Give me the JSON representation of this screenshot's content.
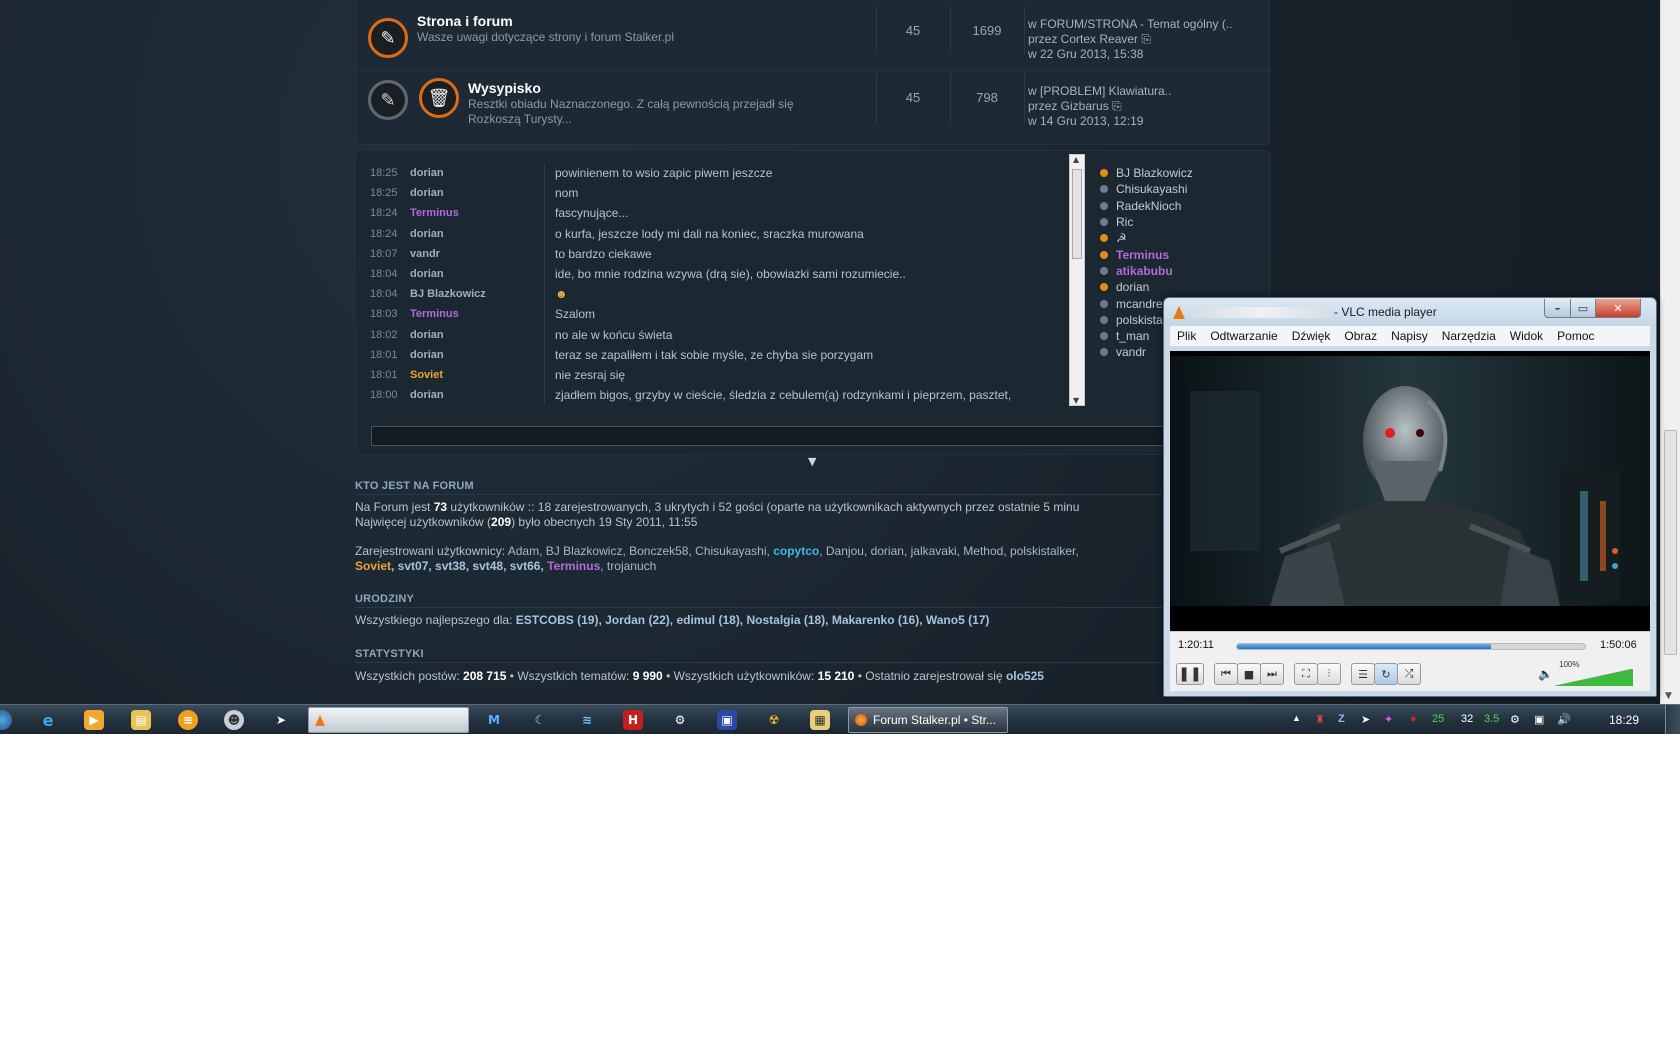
{
  "forums": [
    {
      "title": "Strona i forum",
      "desc": "Wasze uwagi dotyczące strony i forum Stalker.pl",
      "topics": "45",
      "posts": "1699",
      "last_line1": "w FORUM/STRONA - Temat ogólny (..",
      "last_line2": "przez Cortex Reaver",
      "last_line3": "w 22 Gru 2013, 15:38"
    },
    {
      "title": "Wysypisko",
      "desc": "Resztki obiadu Naznaczonego. Z całą pewnością przejadł się Rozkoszą Turysty...",
      "topics": "45",
      "posts": "798",
      "last_line1": "w [PROBLEM] Klawiatura..",
      "last_line2": "przez Gizbarus",
      "last_line3": "w 14 Gru 2013, 12:19"
    }
  ],
  "shoutbox": {
    "lines": [
      {
        "time": "18:25",
        "nick": "dorian",
        "msg": "powinienem to wsio zapic piwem jeszcze"
      },
      {
        "time": "18:25",
        "nick": "dorian",
        "msg": "nom"
      },
      {
        "time": "18:24",
        "nick": "Terminus",
        "msg": "fascynujące..."
      },
      {
        "time": "18:24",
        "nick": "dorian",
        "msg": "o kurfa, jeszcze lody mi dali na koniec, sraczka murowana"
      },
      {
        "time": "18:07",
        "nick": "vandr",
        "msg": "to bardzo ciekawe"
      },
      {
        "time": "18:04",
        "nick": "dorian",
        "msg": "ide, bo mnie rodzina wzywa (drą sie), obowiazki sami rozumiecie.."
      },
      {
        "time": "18:04",
        "nick": "BJ Blazkowicz",
        "msg": ""
      },
      {
        "time": "18:03",
        "nick": "Terminus",
        "msg": "Szalom"
      },
      {
        "time": "18:02",
        "nick": "dorian",
        "msg": "no ale w końcu świeta"
      },
      {
        "time": "18:01",
        "nick": "dorian",
        "msg": "teraz se zapaliłem i tak sobie myśle, ze chyba sie porzygam"
      },
      {
        "time": "18:01",
        "nick": "Soviet",
        "msg": "nie zesraj się"
      },
      {
        "time": "18:00",
        "nick": "dorian",
        "msg": "zjadłem bigos, grzyby w cieście, śledzia z cebulem(ą) rodzynkami i pieprzem, pasztet,"
      }
    ],
    "online": [
      "BJ Blazkowicz",
      "Chisukayashi",
      "RadekNioch",
      "Ric",
      "☭",
      "Terminus",
      "atikabubu",
      "dorian",
      "mcandre",
      "polskista",
      "t_man",
      "vandr"
    ]
  },
  "who_online": {
    "heading": "KTO JEST NA FORUM",
    "line1_a": "Na Forum jest",
    "line1_count": "73",
    "line1_b": "użytkowników :: 18 zarejestrowanych, 3 ukrytych i 52 gości (oparte na użytkownikach aktywnych przez ostatnie 5 minu",
    "line2_a": "Najwięcej użytkowników (",
    "line2_count": "209",
    "line2_b": ") było obecnych 19 Sty 2011, 11:55",
    "registered_label": "Zarejestrowani użytkownicy:",
    "registered_1": "Adam, BJ Blazkowicz, Bonczek58, Chisukayashi,",
    "registered_cyan": "copytco",
    "registered_2": ", Danjou, dorian, jalkavaki, Method, polskistalker,",
    "r2_soviet": "Soviet",
    "r2_users": ", svt07, svt38, svt48, svt66,",
    "r2_terminus": "Terminus",
    "r2_end": ", trojanuch"
  },
  "birthdays": {
    "heading": "URODZINY",
    "label": "Wszystkiego najlepszego dla:",
    "people": "ESTCOBS (19), Jordan (22), edimul (18), Nostalgia (18), Makarenko (16), Wano5 (17)"
  },
  "stats": {
    "heading": "STATYSTYKI",
    "posts_label": "Wszystkich postów:",
    "posts": "208 715",
    "topics_label": "• Wszystkich tematów:",
    "topics": "9 990",
    "users_label": "• Wszystkich użytkowników:",
    "users": "15 210",
    "newest_label": "• Ostatnio zarejestrował się",
    "newest": "olo525"
  },
  "vlc": {
    "title": "- VLC media player",
    "menu": [
      "Plik",
      "Odtwarzanie",
      "Dźwięk",
      "Obraz",
      "Napisy",
      "Narzędzia",
      "Widok",
      "Pomoc"
    ],
    "elapsed": "1:20:11",
    "total": "1:50:06",
    "progress_fraction": 0.73,
    "volume_label": "100%",
    "volume_fraction": 1.0
  },
  "taskbar": {
    "active_task": "Forum Stalker.pl • Str...",
    "tray_numbers": [
      "25",
      "32",
      "3.5"
    ],
    "clock": "18:29"
  },
  "colors": {
    "accent_orange": "#e06b14",
    "nick_purple": "#b36bd8",
    "nick_orange": "#f0a430",
    "link_cyan": "#40b8e8"
  }
}
